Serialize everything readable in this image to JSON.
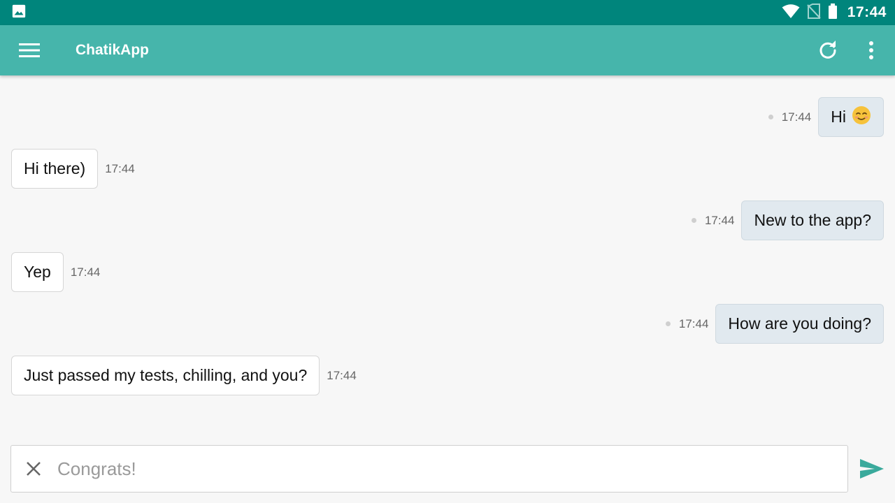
{
  "status_bar": {
    "time": "17:44",
    "icons": [
      "image-icon",
      "wifi-icon",
      "no-sim-icon",
      "battery-icon"
    ]
  },
  "app_bar": {
    "title": "ChatikApp",
    "icons": [
      "menu-icon",
      "refresh-icon",
      "more-vert-icon"
    ]
  },
  "messages": [
    {
      "direction": "out",
      "text": "Hi",
      "emoji": "smiling-face",
      "time": "17:44"
    },
    {
      "direction": "in",
      "text": "Hi there)",
      "time": "17:44"
    },
    {
      "direction": "out",
      "text": "New to the app?",
      "time": "17:44"
    },
    {
      "direction": "in",
      "text": "Yep",
      "time": "17:44"
    },
    {
      "direction": "out",
      "text": "How are you doing?",
      "time": "17:44"
    },
    {
      "direction": "in",
      "text": "Just passed my tests, chilling, and you?",
      "time": "17:44"
    }
  ],
  "composer": {
    "placeholder": "Congrats!",
    "value": ""
  },
  "colors": {
    "status_bar": "#00857c",
    "app_bar": "#46b5ab",
    "accent": "#3aaa9c",
    "outgoing_bubble": "#e1e9ef",
    "incoming_bubble": "#ffffff",
    "background": "#f7f7f7"
  }
}
